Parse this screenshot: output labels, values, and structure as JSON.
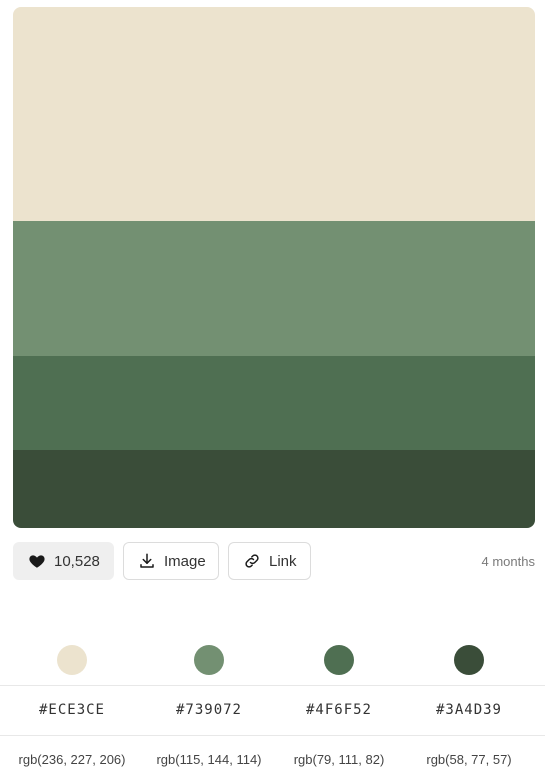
{
  "palette": {
    "colors": [
      {
        "hex": "#ECE3CE",
        "rgb": "rgb(236, 227, 206)"
      },
      {
        "hex": "#739072",
        "rgb": "rgb(115, 144, 114)"
      },
      {
        "hex": "#4F6F52",
        "rgb": "rgb(79, 111, 82)"
      },
      {
        "hex": "#3A4D39",
        "rgb": "rgb(58, 77, 57)"
      }
    ]
  },
  "actions": {
    "likes": "10,528",
    "image_label": "Image",
    "link_label": "Link",
    "icons": {
      "like": "heart-icon",
      "image": "download-icon",
      "link": "link-icon"
    }
  },
  "meta": {
    "time_ago": "4 months"
  }
}
